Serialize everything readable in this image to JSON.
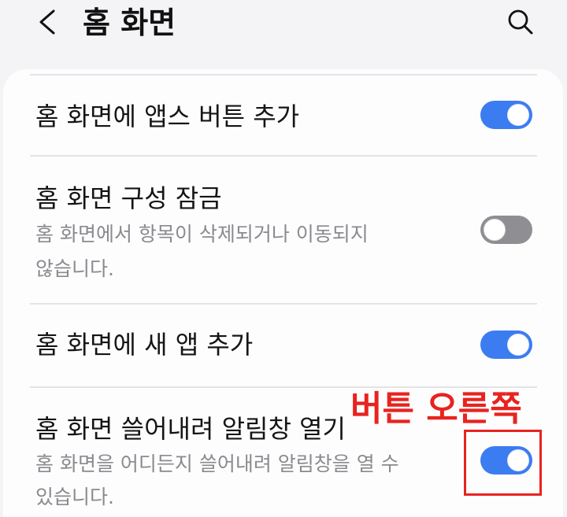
{
  "header": {
    "title": "홈 화면",
    "back_icon": "chevron-left-icon",
    "search_icon": "search-icon"
  },
  "settings": [
    {
      "title": "홈 화면에 앱스 버튼 추가",
      "subtitle_lines": [],
      "toggle_on": true
    },
    {
      "title": "홈 화면 구성 잠금",
      "subtitle_lines": [
        "홈 화면에서 항목이 삭제되거나 이동되지",
        "않습니다."
      ],
      "toggle_on": false
    },
    {
      "title": "홈 화면에 새 앱 추가",
      "subtitle_lines": [],
      "toggle_on": true
    },
    {
      "title": "홈 화면 쓸어내려 알림창 열기",
      "subtitle_lines": [
        "홈 화면을 어디든지 쓸어내려 알림창을 열 수",
        "있습니다."
      ],
      "toggle_on": true
    }
  ],
  "annotation": {
    "label": "버튼 오른쪽",
    "color": "#e8231f"
  },
  "colors": {
    "background": "#f4f4f6",
    "card": "#fdfdfe",
    "toggle_on": "#3c7cf1",
    "toggle_off": "#8e8e93",
    "subtitle_text": "#8a8a8f"
  }
}
